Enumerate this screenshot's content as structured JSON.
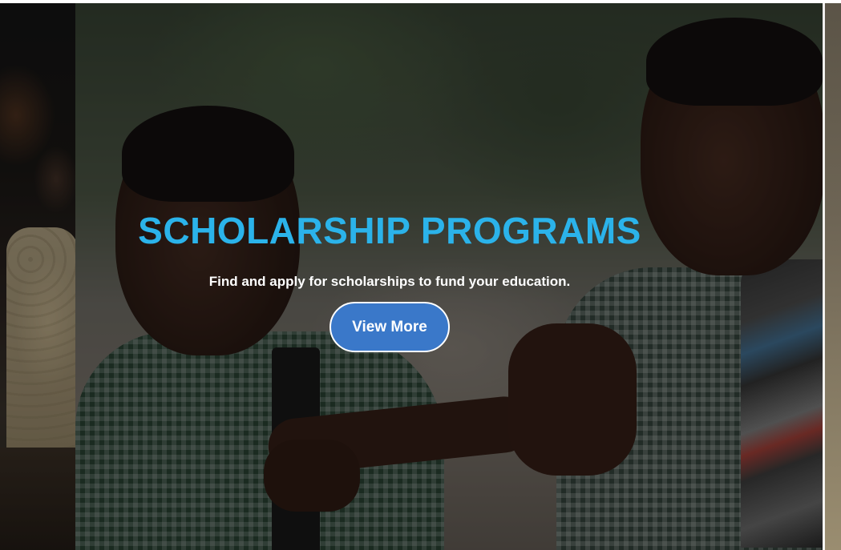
{
  "hero": {
    "title": "SCHOLARSHIP PROGRAMS",
    "subtitle": "Find and apply for scholarships to fund your education.",
    "cta_label": "View More"
  },
  "colors": {
    "title": "#2bb3ea",
    "cta_background": "#3a78c9",
    "cta_border": "#ffffff",
    "subtitle": "#ffffff"
  },
  "carousel": {
    "slides_visible": [
      "previous-slide-partial",
      "current-slide",
      "next-slide-partial"
    ]
  }
}
